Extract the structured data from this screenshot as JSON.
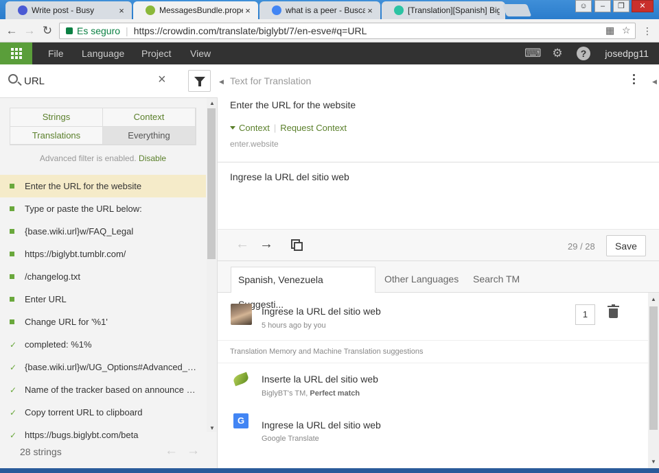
{
  "browser": {
    "tabs": [
      {
        "title": "Write post - Busy",
        "color": "#4a5ad4"
      },
      {
        "title": "MessagesBundle.properti",
        "color": "#8bb83a",
        "active": true
      },
      {
        "title": "what is a peer - Buscar co",
        "color": "#4285f4"
      },
      {
        "title": "[Translation][Spanish] Big",
        "color": "#2bc3a3"
      }
    ],
    "close_glyph": "×",
    "secure_label": "Es seguro",
    "url": "https://crowdin.com/translate/biglybt/7/en-esve#q=URL",
    "translate_icon": "translate-icon",
    "star_icon": "star-icon"
  },
  "app": {
    "menu": [
      "File",
      "Language",
      "Project",
      "View"
    ],
    "username": "josedpg11"
  },
  "left": {
    "search_value": "URL",
    "filters": {
      "strings": "Strings",
      "context": "Context",
      "translations": "Translations",
      "everything": "Everything"
    },
    "advanced_text": "Advanced filter is enabled.",
    "disable_label": "Disable",
    "strings": [
      {
        "text": "Enter the URL for the website",
        "status": "translated",
        "active": true
      },
      {
        "text": "Type or paste the URL below:",
        "status": "translated"
      },
      {
        "text": "{base.wiki.url}w/FAQ_Legal",
        "status": "translated"
      },
      {
        "text": "https://biglybt.tumblr.com/",
        "status": "translated"
      },
      {
        "text": "/changelog.txt",
        "status": "translated"
      },
      {
        "text": "Enter URL",
        "status": "translated"
      },
      {
        "text": "Change URL for '%1'",
        "status": "translated"
      },
      {
        "text": "completed: %1%",
        "status": "approved"
      },
      {
        "text": "{base.wiki.url}w/UG_Options#Advanced_N...",
        "status": "approved"
      },
      {
        "text": "Name of the tracker based on announce U...",
        "status": "approved"
      },
      {
        "text": "Copy torrent URL to clipboard",
        "status": "approved"
      },
      {
        "text": "https://bugs.biglybt.com/beta",
        "status": "approved"
      }
    ],
    "count_label": "28 strings"
  },
  "right": {
    "source_label": "Text for Translation",
    "source_text": "Enter the URL for the website",
    "context_link": "Context",
    "request_context": "Request Context",
    "context_key": "enter.website",
    "translation": "Ingrese la URL del sitio web",
    "progress": "29 / 28",
    "save_label": "Save",
    "tabs": [
      "Spanish, Venezuela Suggesti...",
      "Other Languages",
      "Search TM"
    ],
    "own_suggestion": {
      "text": "Ingrese la URL del sitio web",
      "meta": "5 hours ago by you",
      "votes": "1"
    },
    "tm_header": "Translation Memory and Machine Translation suggestions",
    "tm_suggestions": [
      {
        "text": "Inserte la URL del sitio web",
        "source": "BiglyBT's TM,",
        "match": "Perfect match",
        "icon": "biglybt-leaf-icon"
      },
      {
        "text": "Ingrese la URL del sitio web",
        "source": "Google Translate",
        "match": "",
        "icon": "google-translate-icon"
      }
    ]
  }
}
